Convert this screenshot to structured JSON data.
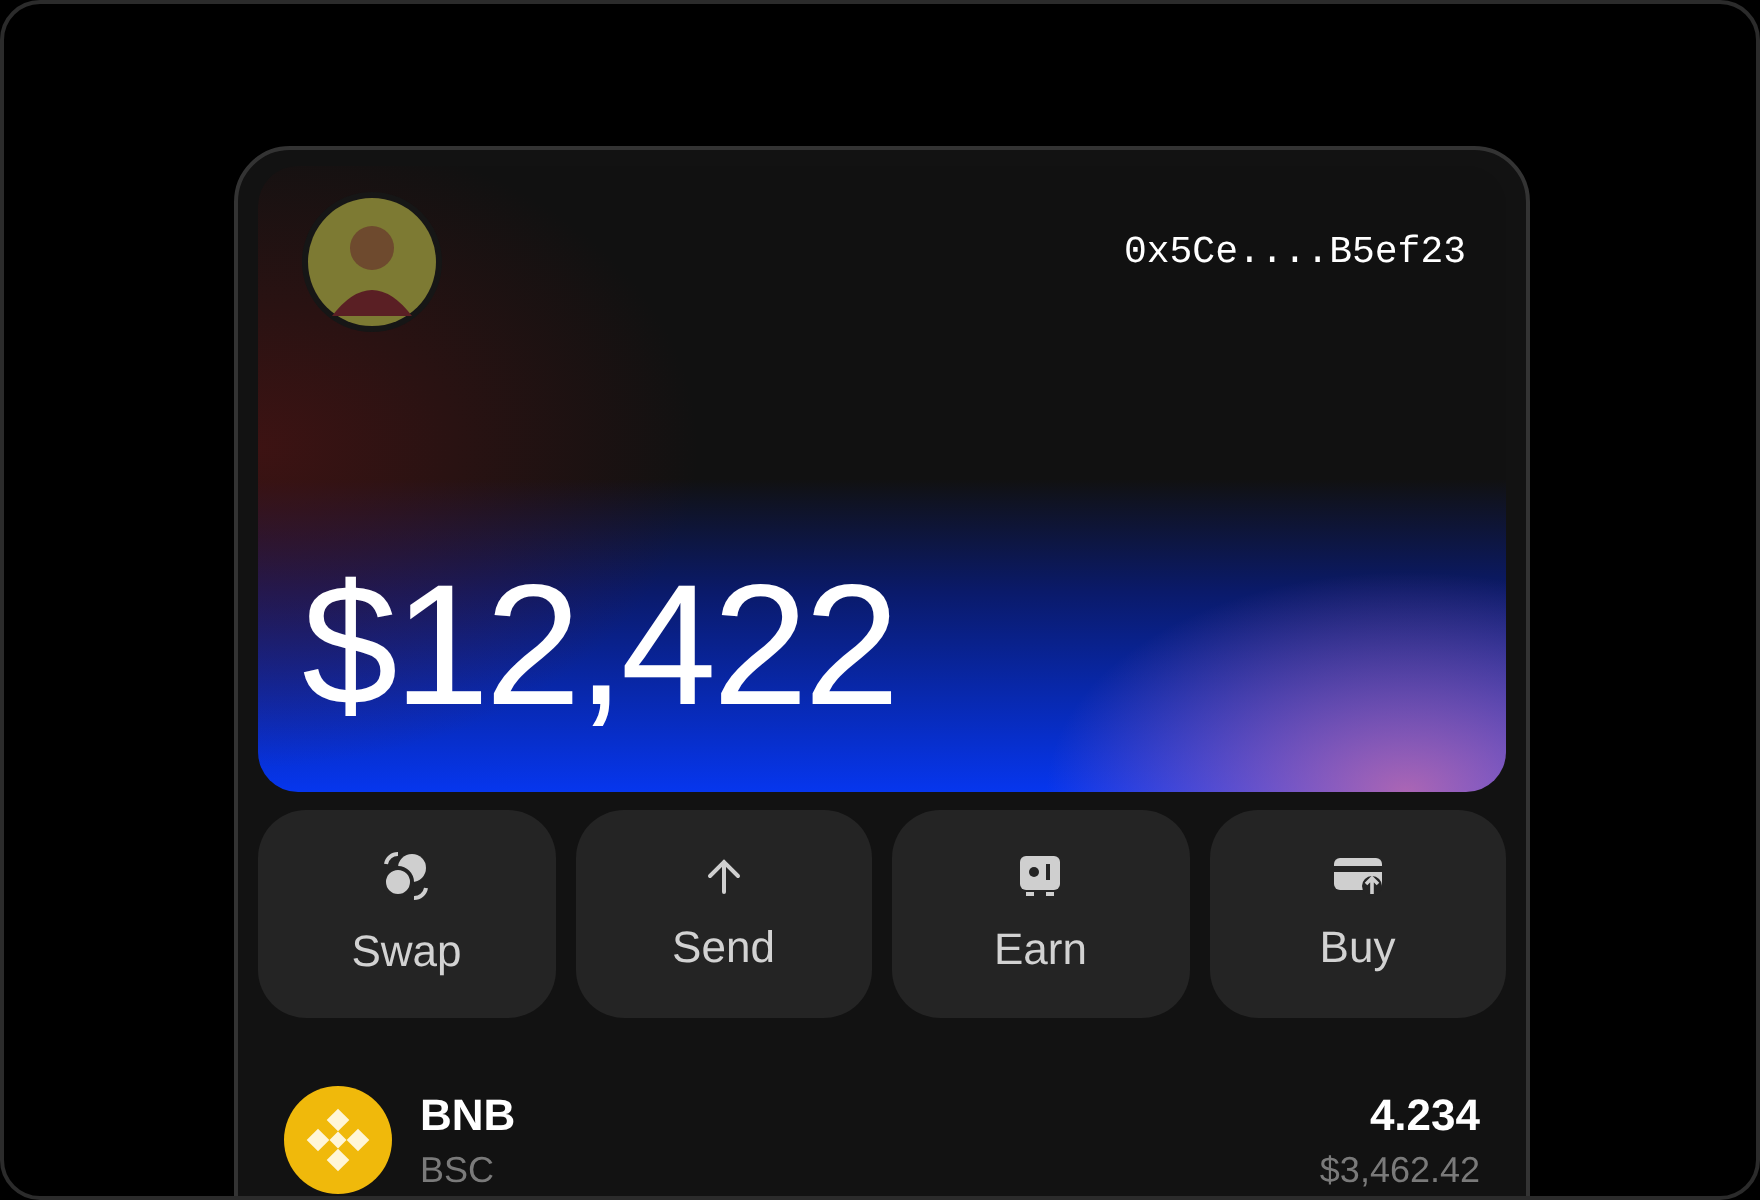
{
  "wallet": {
    "address": "0x5Ce....B5ef23",
    "balance": "$12,422"
  },
  "actions": [
    {
      "kind": "swap",
      "label": "Swap"
    },
    {
      "kind": "send",
      "label": "Send"
    },
    {
      "kind": "earn",
      "label": "Earn"
    },
    {
      "kind": "buy",
      "label": "Buy"
    }
  ],
  "assets": [
    {
      "symbol": "BNB",
      "network": "BSC",
      "amount": "4.234",
      "value": "$3,462.42",
      "color": "#f0b90b"
    }
  ]
}
